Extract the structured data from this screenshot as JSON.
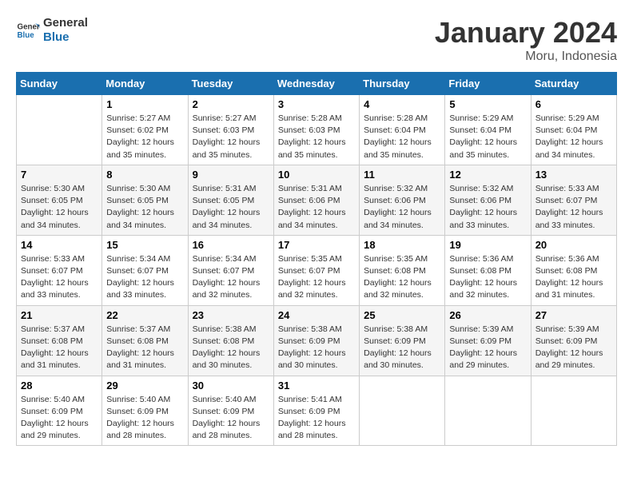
{
  "logo": {
    "line1": "General",
    "line2": "Blue"
  },
  "title": "January 2024",
  "subtitle": "Moru, Indonesia",
  "days_header": [
    "Sunday",
    "Monday",
    "Tuesday",
    "Wednesday",
    "Thursday",
    "Friday",
    "Saturday"
  ],
  "weeks": [
    [
      {
        "day": "",
        "info": ""
      },
      {
        "day": "1",
        "info": "Sunrise: 5:27 AM\nSunset: 6:02 PM\nDaylight: 12 hours\nand 35 minutes."
      },
      {
        "day": "2",
        "info": "Sunrise: 5:27 AM\nSunset: 6:03 PM\nDaylight: 12 hours\nand 35 minutes."
      },
      {
        "day": "3",
        "info": "Sunrise: 5:28 AM\nSunset: 6:03 PM\nDaylight: 12 hours\nand 35 minutes."
      },
      {
        "day": "4",
        "info": "Sunrise: 5:28 AM\nSunset: 6:04 PM\nDaylight: 12 hours\nand 35 minutes."
      },
      {
        "day": "5",
        "info": "Sunrise: 5:29 AM\nSunset: 6:04 PM\nDaylight: 12 hours\nand 35 minutes."
      },
      {
        "day": "6",
        "info": "Sunrise: 5:29 AM\nSunset: 6:04 PM\nDaylight: 12 hours\nand 34 minutes."
      }
    ],
    [
      {
        "day": "7",
        "info": "Sunrise: 5:30 AM\nSunset: 6:05 PM\nDaylight: 12 hours\nand 34 minutes."
      },
      {
        "day": "8",
        "info": "Sunrise: 5:30 AM\nSunset: 6:05 PM\nDaylight: 12 hours\nand 34 minutes."
      },
      {
        "day": "9",
        "info": "Sunrise: 5:31 AM\nSunset: 6:05 PM\nDaylight: 12 hours\nand 34 minutes."
      },
      {
        "day": "10",
        "info": "Sunrise: 5:31 AM\nSunset: 6:06 PM\nDaylight: 12 hours\nand 34 minutes."
      },
      {
        "day": "11",
        "info": "Sunrise: 5:32 AM\nSunset: 6:06 PM\nDaylight: 12 hours\nand 34 minutes."
      },
      {
        "day": "12",
        "info": "Sunrise: 5:32 AM\nSunset: 6:06 PM\nDaylight: 12 hours\nand 33 minutes."
      },
      {
        "day": "13",
        "info": "Sunrise: 5:33 AM\nSunset: 6:07 PM\nDaylight: 12 hours\nand 33 minutes."
      }
    ],
    [
      {
        "day": "14",
        "info": "Sunrise: 5:33 AM\nSunset: 6:07 PM\nDaylight: 12 hours\nand 33 minutes."
      },
      {
        "day": "15",
        "info": "Sunrise: 5:34 AM\nSunset: 6:07 PM\nDaylight: 12 hours\nand 33 minutes."
      },
      {
        "day": "16",
        "info": "Sunrise: 5:34 AM\nSunset: 6:07 PM\nDaylight: 12 hours\nand 32 minutes."
      },
      {
        "day": "17",
        "info": "Sunrise: 5:35 AM\nSunset: 6:07 PM\nDaylight: 12 hours\nand 32 minutes."
      },
      {
        "day": "18",
        "info": "Sunrise: 5:35 AM\nSunset: 6:08 PM\nDaylight: 12 hours\nand 32 minutes."
      },
      {
        "day": "19",
        "info": "Sunrise: 5:36 AM\nSunset: 6:08 PM\nDaylight: 12 hours\nand 32 minutes."
      },
      {
        "day": "20",
        "info": "Sunrise: 5:36 AM\nSunset: 6:08 PM\nDaylight: 12 hours\nand 31 minutes."
      }
    ],
    [
      {
        "day": "21",
        "info": "Sunrise: 5:37 AM\nSunset: 6:08 PM\nDaylight: 12 hours\nand 31 minutes."
      },
      {
        "day": "22",
        "info": "Sunrise: 5:37 AM\nSunset: 6:08 PM\nDaylight: 12 hours\nand 31 minutes."
      },
      {
        "day": "23",
        "info": "Sunrise: 5:38 AM\nSunset: 6:08 PM\nDaylight: 12 hours\nand 30 minutes."
      },
      {
        "day": "24",
        "info": "Sunrise: 5:38 AM\nSunset: 6:09 PM\nDaylight: 12 hours\nand 30 minutes."
      },
      {
        "day": "25",
        "info": "Sunrise: 5:38 AM\nSunset: 6:09 PM\nDaylight: 12 hours\nand 30 minutes."
      },
      {
        "day": "26",
        "info": "Sunrise: 5:39 AM\nSunset: 6:09 PM\nDaylight: 12 hours\nand 29 minutes."
      },
      {
        "day": "27",
        "info": "Sunrise: 5:39 AM\nSunset: 6:09 PM\nDaylight: 12 hours\nand 29 minutes."
      }
    ],
    [
      {
        "day": "28",
        "info": "Sunrise: 5:40 AM\nSunset: 6:09 PM\nDaylight: 12 hours\nand 29 minutes."
      },
      {
        "day": "29",
        "info": "Sunrise: 5:40 AM\nSunset: 6:09 PM\nDaylight: 12 hours\nand 28 minutes."
      },
      {
        "day": "30",
        "info": "Sunrise: 5:40 AM\nSunset: 6:09 PM\nDaylight: 12 hours\nand 28 minutes."
      },
      {
        "day": "31",
        "info": "Sunrise: 5:41 AM\nSunset: 6:09 PM\nDaylight: 12 hours\nand 28 minutes."
      },
      {
        "day": "",
        "info": ""
      },
      {
        "day": "",
        "info": ""
      },
      {
        "day": "",
        "info": ""
      }
    ]
  ]
}
